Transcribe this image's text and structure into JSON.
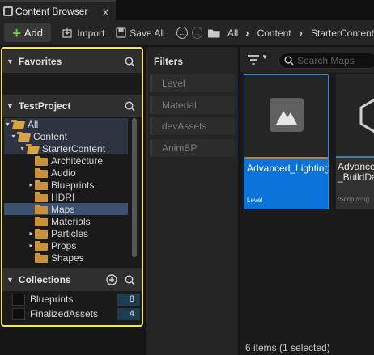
{
  "tab": {
    "title": "Content Browser",
    "close": "x"
  },
  "toolbar": {
    "add_label": "Add",
    "import_label": "Import",
    "save_all_label": "Save All",
    "breadcrumb": [
      "All",
      "Content",
      "StarterContent"
    ]
  },
  "favorites": {
    "title": "Favorites"
  },
  "project": {
    "title": "TestProject",
    "tree": [
      {
        "label": "All"
      },
      {
        "label": "Content"
      },
      {
        "label": "StarterContent"
      },
      {
        "label": "Architecture"
      },
      {
        "label": "Audio"
      },
      {
        "label": "Blueprints"
      },
      {
        "label": "HDRI"
      },
      {
        "label": "Maps"
      },
      {
        "label": "Materials"
      },
      {
        "label": "Particles"
      },
      {
        "label": "Props"
      },
      {
        "label": "Shapes"
      }
    ]
  },
  "collections": {
    "title": "Collections",
    "items": [
      {
        "label": "Blueprints",
        "count": "8"
      },
      {
        "label": "FinalizedAssets",
        "count": "4"
      }
    ]
  },
  "filters": {
    "title": "Filters",
    "items": [
      "Level",
      "Material",
      "devAssets",
      "AnimBP"
    ]
  },
  "search": {
    "placeholder": "Search Maps"
  },
  "assets": [
    {
      "name": "Advanced_Lighting",
      "type": "Level"
    },
    {
      "name_line1": "Advance",
      "name_line2": "_BuildDa",
      "type": "/Script/Eng"
    }
  ],
  "status": "6 items (1 selected)",
  "colors": {
    "accent": "#0a74da",
    "highlight_border": "#f3e45a",
    "add_icon": "#6bcb3b"
  }
}
